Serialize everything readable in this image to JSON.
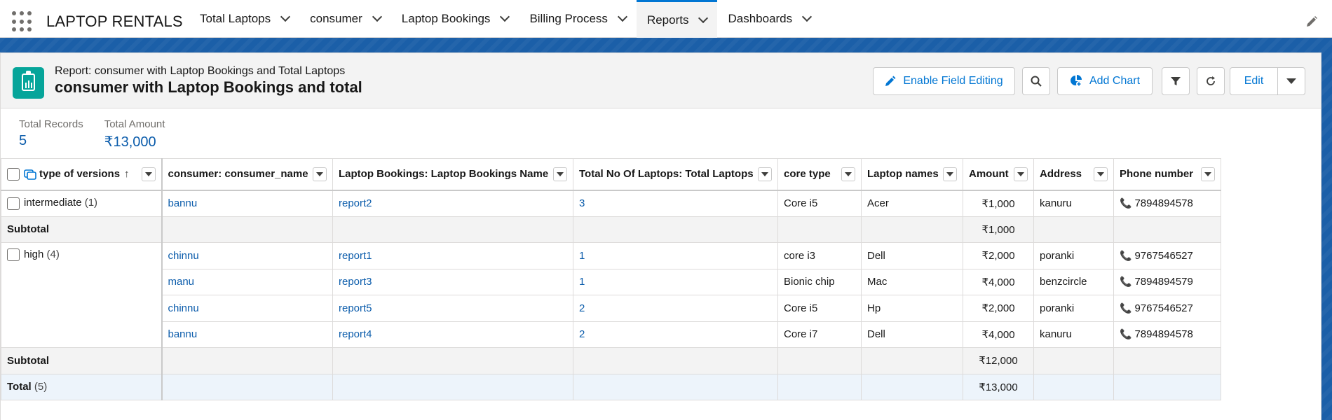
{
  "app": {
    "name": "LAPTOP RENTALS"
  },
  "nav": {
    "tabs": [
      {
        "label": "Total Laptops"
      },
      {
        "label": "consumer"
      },
      {
        "label": "Laptop Bookings"
      },
      {
        "label": "Billing Process"
      },
      {
        "label": "Reports"
      },
      {
        "label": "Dashboards"
      }
    ],
    "active_tab": "Reports"
  },
  "report": {
    "subtitle": "Report: consumer with Laptop Bookings and Total Laptops",
    "title": "consumer with Laptop Bookings and total",
    "buttons": {
      "enable_field_editing": "Enable Field Editing",
      "add_chart": "Add Chart",
      "edit": "Edit"
    }
  },
  "summary": {
    "total_records_label": "Total Records",
    "total_records_value": "5",
    "total_amount_label": "Total Amount",
    "total_amount_value": "₹13,000"
  },
  "table": {
    "columns": [
      "type of versions",
      "consumer: consumer_name",
      "Laptop Bookings: Laptop Bookings Name",
      "Total No Of Laptops: Total Laptops",
      "core type",
      "Laptop names",
      "Amount",
      "Address",
      "Phone number"
    ],
    "groups": [
      {
        "label": "intermediate",
        "count": "(1)",
        "rows": [
          {
            "consumer": "bannu",
            "booking": "report2",
            "laptops": "3",
            "core": "Core i5",
            "name": "Acer",
            "amount": "₹1,000",
            "address": "kanuru",
            "phone": "7894894578"
          }
        ],
        "subtotal_label": "Subtotal",
        "subtotal_amount": "₹1,000"
      },
      {
        "label": "high",
        "count": "(4)",
        "rows": [
          {
            "consumer": "chinnu",
            "booking": "report1",
            "laptops": "1",
            "core": "core i3",
            "name": "Dell",
            "amount": "₹2,000",
            "address": "poranki",
            "phone": "9767546527"
          },
          {
            "consumer": "manu",
            "booking": "report3",
            "laptops": "1",
            "core": "Bionic chip",
            "name": "Mac",
            "amount": "₹4,000",
            "address": "benzcircle",
            "phone": "7894894579"
          },
          {
            "consumer": "chinnu",
            "booking": "report5",
            "laptops": "2",
            "core": "Core i5",
            "name": "Hp",
            "amount": "₹2,000",
            "address": "poranki",
            "phone": "9767546527"
          },
          {
            "consumer": "bannu",
            "booking": "report4",
            "laptops": "2",
            "core": "Core i7",
            "name": "Dell",
            "amount": "₹4,000",
            "address": "kanuru",
            "phone": "7894894578"
          }
        ],
        "subtotal_label": "Subtotal",
        "subtotal_amount": "₹12,000"
      }
    ],
    "total_label": "Total",
    "total_count": "(5)",
    "total_amount": "₹13,000"
  },
  "colors": {
    "accent": "#0176d3",
    "link": "#0b5cab",
    "report_icon": "#06a59a",
    "band": "#1b5fa8"
  },
  "icons": [
    "app-launcher-icon",
    "chevron-down-icon",
    "pencil-icon",
    "report-icon",
    "search-icon",
    "add-chart-icon",
    "filter-icon",
    "refresh-icon",
    "phone-icon",
    "sort-ascending-icon"
  ]
}
